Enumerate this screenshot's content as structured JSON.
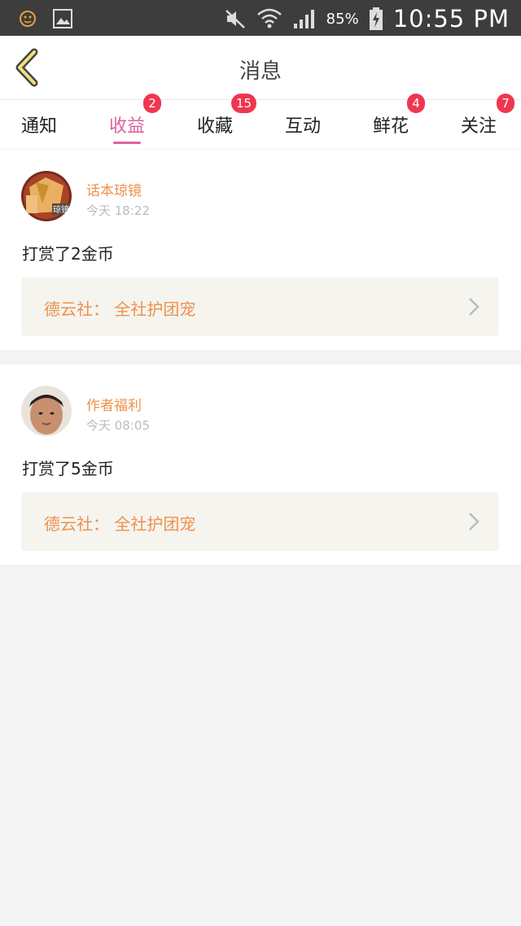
{
  "status_bar": {
    "battery": "85%",
    "time": "10:55 PM"
  },
  "header": {
    "title": "消息"
  },
  "tabs": [
    {
      "label": "通知",
      "badge": ""
    },
    {
      "label": "收益",
      "badge": "2"
    },
    {
      "label": "收藏",
      "badge": "15"
    },
    {
      "label": "互动",
      "badge": ""
    },
    {
      "label": "鲜花",
      "badge": "4"
    },
    {
      "label": "关注",
      "badge": "7"
    }
  ],
  "messages": [
    {
      "sender": "话本琼镜",
      "time": "今天 18:22",
      "text": "打赏了2金币",
      "link": "德云社：  全社护团宠",
      "avatar_label": "琼镜"
    },
    {
      "sender": "作者福利",
      "time": "今天 08:05",
      "text": "打赏了5金币",
      "link": "德云社：  全社护团宠"
    }
  ],
  "colors": {
    "accent": "#e060a0",
    "badge": "#f0364e",
    "sender": "#f0904a",
    "status_bar": "#3d3d3d"
  }
}
